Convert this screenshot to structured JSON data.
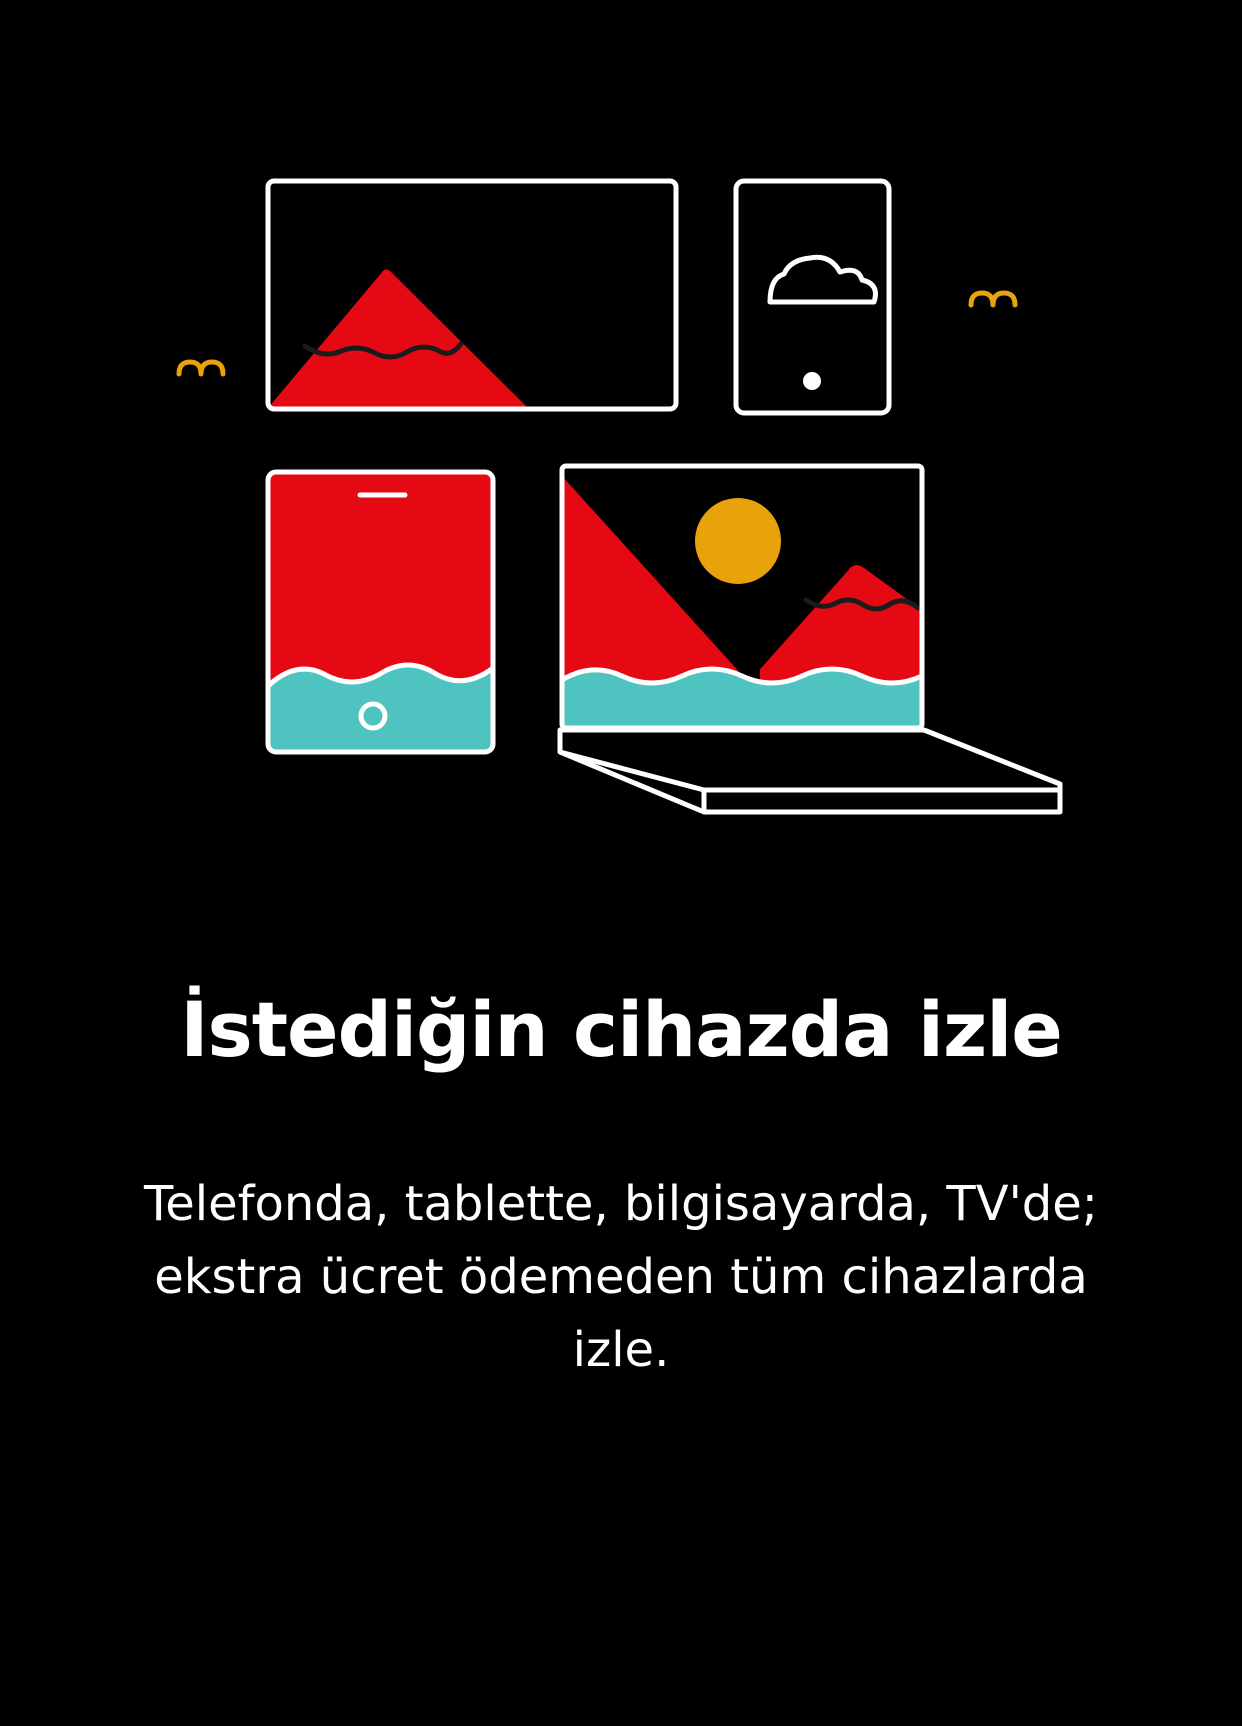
{
  "onboarding": {
    "title": "İstediğin cihazda izle",
    "subtitle": "Telefonda, tablette, bilgisayarda, TV'de; ekstra ücret ödemeden tüm cihazlarda izle."
  },
  "illustration": {
    "icons": [
      "tv-icon",
      "phone-icon",
      "tablet-icon",
      "laptop-icon",
      "bird-icon"
    ],
    "colors": {
      "background": "#000000",
      "outline": "#ffffff",
      "red": "#e50914",
      "teal": "#4fc3c0",
      "gold": "#e8a20c"
    }
  }
}
